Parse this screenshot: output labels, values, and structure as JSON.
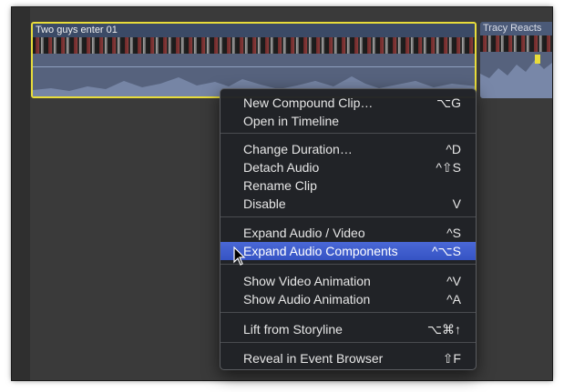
{
  "timeline": {
    "clip_primary_title": "Two guys enter 01",
    "clip_secondary_title": "Tracy Reacts",
    "selection_color": "#e8dc3a"
  },
  "context_menu": {
    "items": [
      {
        "label": "New Compound Clip…",
        "shortcut": "⌥G"
      },
      {
        "label": "Open in Timeline",
        "shortcut": ""
      },
      {
        "label": "Change Duration…",
        "shortcut": "^D"
      },
      {
        "label": "Detach Audio",
        "shortcut": "^⇧S"
      },
      {
        "label": "Rename Clip",
        "shortcut": ""
      },
      {
        "label": "Disable",
        "shortcut": "V"
      },
      {
        "label": "Expand Audio / Video",
        "shortcut": "^S"
      },
      {
        "label": "Expand Audio Components",
        "shortcut": "^⌥S",
        "highlighted": true
      },
      {
        "label": "Show Video Animation",
        "shortcut": "^V"
      },
      {
        "label": "Show Audio Animation",
        "shortcut": "^A"
      },
      {
        "label": "Lift from Storyline",
        "shortcut": "⌥⌘↑"
      },
      {
        "label": "Reveal in Event Browser",
        "shortcut": "⇧F"
      }
    ],
    "highlight_color": "#3d5bd0"
  }
}
